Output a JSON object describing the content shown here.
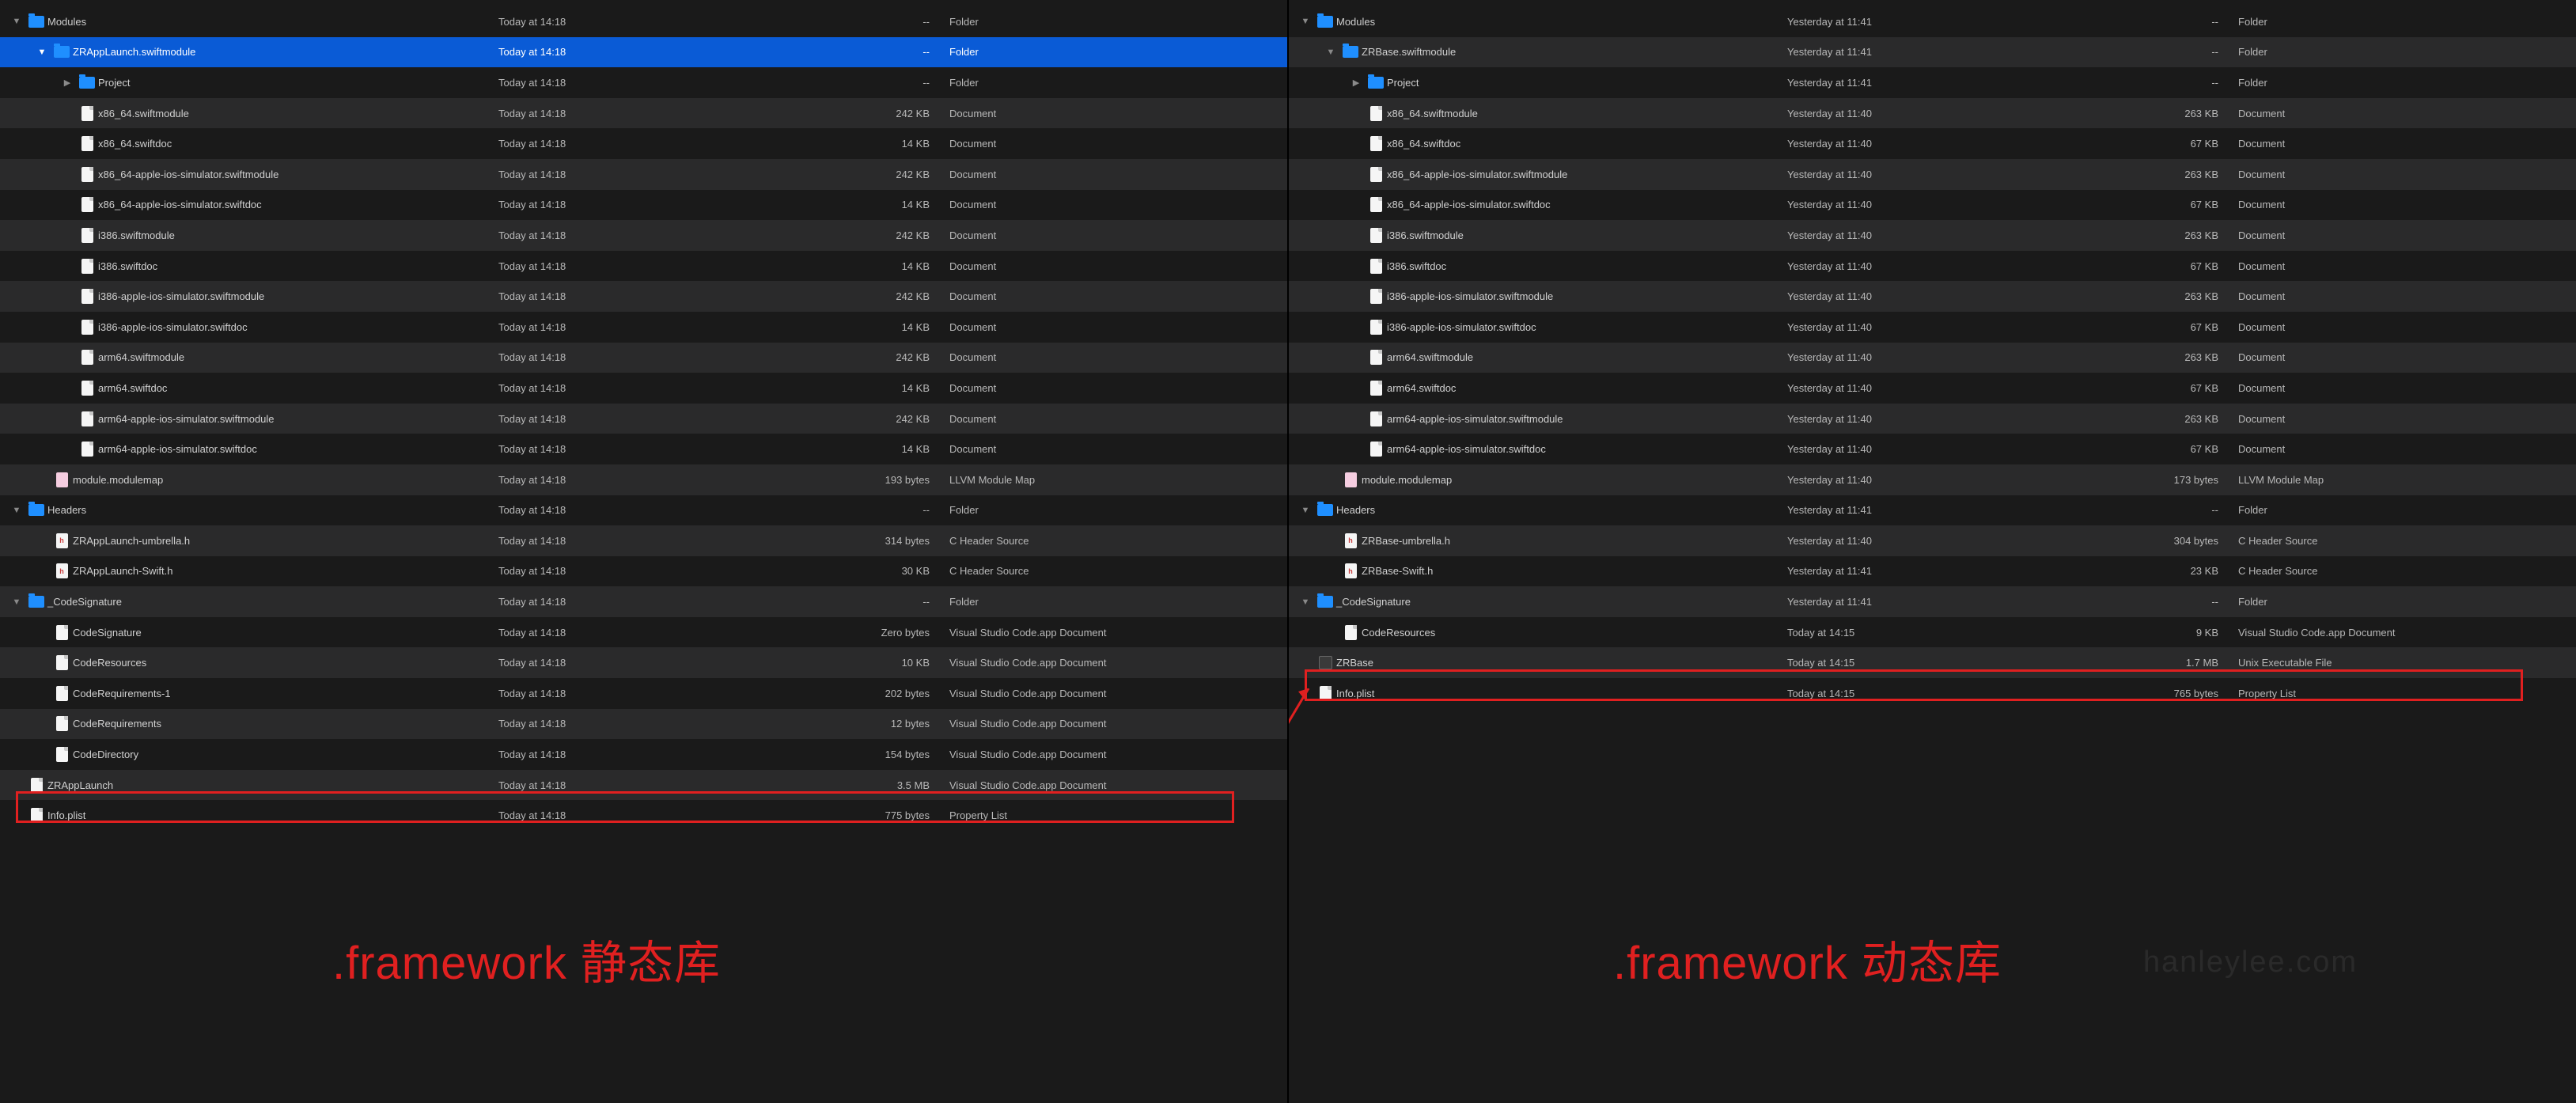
{
  "left": {
    "caption": ".framework 静态库",
    "rows": [
      {
        "indent": 0,
        "disc": "down",
        "icon": "folder",
        "name": "Modules",
        "date": "Today at 14:18",
        "size": "--",
        "kind": "Folder",
        "alt": false,
        "sel": false
      },
      {
        "indent": 1,
        "disc": "down",
        "icon": "folder",
        "name": "ZRAppLaunch.swiftmodule",
        "date": "Today at 14:18",
        "size": "--",
        "kind": "Folder",
        "alt": true,
        "sel": true
      },
      {
        "indent": 2,
        "disc": "right",
        "icon": "folder",
        "name": "Project",
        "date": "Today at 14:18",
        "size": "--",
        "kind": "Folder",
        "alt": false,
        "sel": false
      },
      {
        "indent": 2,
        "disc": "",
        "icon": "doc",
        "name": "x86_64.swiftmodule",
        "date": "Today at 14:18",
        "size": "242 KB",
        "kind": "Document",
        "alt": true,
        "sel": false
      },
      {
        "indent": 2,
        "disc": "",
        "icon": "doc",
        "name": "x86_64.swiftdoc",
        "date": "Today at 14:18",
        "size": "14 KB",
        "kind": "Document",
        "alt": false,
        "sel": false
      },
      {
        "indent": 2,
        "disc": "",
        "icon": "doc",
        "name": "x86_64-apple-ios-simulator.swiftmodule",
        "date": "Today at 14:18",
        "size": "242 KB",
        "kind": "Document",
        "alt": true,
        "sel": false
      },
      {
        "indent": 2,
        "disc": "",
        "icon": "doc",
        "name": "x86_64-apple-ios-simulator.swiftdoc",
        "date": "Today at 14:18",
        "size": "14 KB",
        "kind": "Document",
        "alt": false,
        "sel": false
      },
      {
        "indent": 2,
        "disc": "",
        "icon": "doc",
        "name": "i386.swiftmodule",
        "date": "Today at 14:18",
        "size": "242 KB",
        "kind": "Document",
        "alt": true,
        "sel": false
      },
      {
        "indent": 2,
        "disc": "",
        "icon": "doc",
        "name": "i386.swiftdoc",
        "date": "Today at 14:18",
        "size": "14 KB",
        "kind": "Document",
        "alt": false,
        "sel": false
      },
      {
        "indent": 2,
        "disc": "",
        "icon": "doc",
        "name": "i386-apple-ios-simulator.swiftmodule",
        "date": "Today at 14:18",
        "size": "242 KB",
        "kind": "Document",
        "alt": true,
        "sel": false
      },
      {
        "indent": 2,
        "disc": "",
        "icon": "doc",
        "name": "i386-apple-ios-simulator.swiftdoc",
        "date": "Today at 14:18",
        "size": "14 KB",
        "kind": "Document",
        "alt": false,
        "sel": false
      },
      {
        "indent": 2,
        "disc": "",
        "icon": "doc",
        "name": "arm64.swiftmodule",
        "date": "Today at 14:18",
        "size": "242 KB",
        "kind": "Document",
        "alt": true,
        "sel": false
      },
      {
        "indent": 2,
        "disc": "",
        "icon": "doc",
        "name": "arm64.swiftdoc",
        "date": "Today at 14:18",
        "size": "14 KB",
        "kind": "Document",
        "alt": false,
        "sel": false
      },
      {
        "indent": 2,
        "disc": "",
        "icon": "doc",
        "name": "arm64-apple-ios-simulator.swiftmodule",
        "date": "Today at 14:18",
        "size": "242 KB",
        "kind": "Document",
        "alt": true,
        "sel": false
      },
      {
        "indent": 2,
        "disc": "",
        "icon": "doc",
        "name": "arm64-apple-ios-simulator.swiftdoc",
        "date": "Today at 14:18",
        "size": "14 KB",
        "kind": "Document",
        "alt": false,
        "sel": false
      },
      {
        "indent": 1,
        "disc": "",
        "icon": "map",
        "name": "module.modulemap",
        "date": "Today at 14:18",
        "size": "193 bytes",
        "kind": "LLVM Module Map",
        "alt": true,
        "sel": false
      },
      {
        "indent": 0,
        "disc": "down",
        "icon": "folder",
        "name": "Headers",
        "date": "Today at 14:18",
        "size": "--",
        "kind": "Folder",
        "alt": false,
        "sel": false
      },
      {
        "indent": 1,
        "disc": "",
        "icon": "h",
        "name": "ZRAppLaunch-umbrella.h",
        "date": "Today at 14:18",
        "size": "314 bytes",
        "kind": "C Header Source",
        "alt": true,
        "sel": false
      },
      {
        "indent": 1,
        "disc": "",
        "icon": "h",
        "name": "ZRAppLaunch-Swift.h",
        "date": "Today at 14:18",
        "size": "30 KB",
        "kind": "C Header Source",
        "alt": false,
        "sel": false
      },
      {
        "indent": 0,
        "disc": "down",
        "icon": "folder",
        "name": "_CodeSignature",
        "date": "Today at 14:18",
        "size": "--",
        "kind": "Folder",
        "alt": true,
        "sel": false
      },
      {
        "indent": 1,
        "disc": "",
        "icon": "doc",
        "name": "CodeSignature",
        "date": "Today at 14:18",
        "size": "Zero bytes",
        "kind": "Visual Studio Code.app Document",
        "alt": false,
        "sel": false
      },
      {
        "indent": 1,
        "disc": "",
        "icon": "doc",
        "name": "CodeResources",
        "date": "Today at 14:18",
        "size": "10 KB",
        "kind": "Visual Studio Code.app Document",
        "alt": true,
        "sel": false
      },
      {
        "indent": 1,
        "disc": "",
        "icon": "doc",
        "name": "CodeRequirements-1",
        "date": "Today at 14:18",
        "size": "202 bytes",
        "kind": "Visual Studio Code.app Document",
        "alt": false,
        "sel": false
      },
      {
        "indent": 1,
        "disc": "",
        "icon": "doc",
        "name": "CodeRequirements",
        "date": "Today at 14:18",
        "size": "12 bytes",
        "kind": "Visual Studio Code.app Document",
        "alt": true,
        "sel": false
      },
      {
        "indent": 1,
        "disc": "",
        "icon": "doc",
        "name": "CodeDirectory",
        "date": "Today at 14:18",
        "size": "154 bytes",
        "kind": "Visual Studio Code.app Document",
        "alt": false,
        "sel": false
      },
      {
        "indent": 0,
        "disc": "",
        "icon": "doc",
        "name": "ZRAppLaunch",
        "date": "Today at 14:18",
        "size": "3.5 MB",
        "kind": "Visual Studio Code.app Document",
        "alt": true,
        "sel": false
      },
      {
        "indent": 0,
        "disc": "",
        "icon": "doc",
        "name": "Info.plist",
        "date": "Today at 14:18",
        "size": "775 bytes",
        "kind": "Property List",
        "alt": false,
        "sel": false
      }
    ]
  },
  "right": {
    "caption": ".framework 动态库",
    "watermark": "hanleylee.com",
    "rows": [
      {
        "indent": 0,
        "disc": "down",
        "icon": "folder",
        "name": "Modules",
        "date": "Yesterday at 11:41",
        "size": "--",
        "kind": "Folder",
        "alt": false,
        "sel": false
      },
      {
        "indent": 1,
        "disc": "down",
        "icon": "folder",
        "name": "ZRBase.swiftmodule",
        "date": "Yesterday at 11:41",
        "size": "--",
        "kind": "Folder",
        "alt": true,
        "sel": false
      },
      {
        "indent": 2,
        "disc": "right",
        "icon": "folder",
        "name": "Project",
        "date": "Yesterday at 11:41",
        "size": "--",
        "kind": "Folder",
        "alt": false,
        "sel": false
      },
      {
        "indent": 2,
        "disc": "",
        "icon": "doc",
        "name": "x86_64.swiftmodule",
        "date": "Yesterday at 11:40",
        "size": "263 KB",
        "kind": "Document",
        "alt": true,
        "sel": false
      },
      {
        "indent": 2,
        "disc": "",
        "icon": "doc",
        "name": "x86_64.swiftdoc",
        "date": "Yesterday at 11:40",
        "size": "67 KB",
        "kind": "Document",
        "alt": false,
        "sel": false
      },
      {
        "indent": 2,
        "disc": "",
        "icon": "doc",
        "name": "x86_64-apple-ios-simulator.swiftmodule",
        "date": "Yesterday at 11:40",
        "size": "263 KB",
        "kind": "Document",
        "alt": true,
        "sel": false
      },
      {
        "indent": 2,
        "disc": "",
        "icon": "doc",
        "name": "x86_64-apple-ios-simulator.swiftdoc",
        "date": "Yesterday at 11:40",
        "size": "67 KB",
        "kind": "Document",
        "alt": false,
        "sel": false
      },
      {
        "indent": 2,
        "disc": "",
        "icon": "doc",
        "name": "i386.swiftmodule",
        "date": "Yesterday at 11:40",
        "size": "263 KB",
        "kind": "Document",
        "alt": true,
        "sel": false
      },
      {
        "indent": 2,
        "disc": "",
        "icon": "doc",
        "name": "i386.swiftdoc",
        "date": "Yesterday at 11:40",
        "size": "67 KB",
        "kind": "Document",
        "alt": false,
        "sel": false
      },
      {
        "indent": 2,
        "disc": "",
        "icon": "doc",
        "name": "i386-apple-ios-simulator.swiftmodule",
        "date": "Yesterday at 11:40",
        "size": "263 KB",
        "kind": "Document",
        "alt": true,
        "sel": false
      },
      {
        "indent": 2,
        "disc": "",
        "icon": "doc",
        "name": "i386-apple-ios-simulator.swiftdoc",
        "date": "Yesterday at 11:40",
        "size": "67 KB",
        "kind": "Document",
        "alt": false,
        "sel": false
      },
      {
        "indent": 2,
        "disc": "",
        "icon": "doc",
        "name": "arm64.swiftmodule",
        "date": "Yesterday at 11:40",
        "size": "263 KB",
        "kind": "Document",
        "alt": true,
        "sel": false
      },
      {
        "indent": 2,
        "disc": "",
        "icon": "doc",
        "name": "arm64.swiftdoc",
        "date": "Yesterday at 11:40",
        "size": "67 KB",
        "kind": "Document",
        "alt": false,
        "sel": false
      },
      {
        "indent": 2,
        "disc": "",
        "icon": "doc",
        "name": "arm64-apple-ios-simulator.swiftmodule",
        "date": "Yesterday at 11:40",
        "size": "263 KB",
        "kind": "Document",
        "alt": true,
        "sel": false
      },
      {
        "indent": 2,
        "disc": "",
        "icon": "doc",
        "name": "arm64-apple-ios-simulator.swiftdoc",
        "date": "Yesterday at 11:40",
        "size": "67 KB",
        "kind": "Document",
        "alt": false,
        "sel": false
      },
      {
        "indent": 1,
        "disc": "",
        "icon": "map",
        "name": "module.modulemap",
        "date": "Yesterday at 11:40",
        "size": "173 bytes",
        "kind": "LLVM Module Map",
        "alt": true,
        "sel": false
      },
      {
        "indent": 0,
        "disc": "down",
        "icon": "folder",
        "name": "Headers",
        "date": "Yesterday at 11:41",
        "size": "--",
        "kind": "Folder",
        "alt": false,
        "sel": false
      },
      {
        "indent": 1,
        "disc": "",
        "icon": "h",
        "name": "ZRBase-umbrella.h",
        "date": "Yesterday at 11:40",
        "size": "304 bytes",
        "kind": "C Header Source",
        "alt": true,
        "sel": false
      },
      {
        "indent": 1,
        "disc": "",
        "icon": "h",
        "name": "ZRBase-Swift.h",
        "date": "Yesterday at 11:41",
        "size": "23 KB",
        "kind": "C Header Source",
        "alt": false,
        "sel": false
      },
      {
        "indent": 0,
        "disc": "down",
        "icon": "folder",
        "name": "_CodeSignature",
        "date": "Yesterday at 11:41",
        "size": "--",
        "kind": "Folder",
        "alt": true,
        "sel": false
      },
      {
        "indent": 1,
        "disc": "",
        "icon": "doc",
        "name": "CodeResources",
        "date": "Today at 14:15",
        "size": "9 KB",
        "kind": "Visual Studio Code.app Document",
        "alt": false,
        "sel": false
      },
      {
        "indent": 0,
        "disc": "",
        "icon": "exec",
        "name": "ZRBase",
        "date": "Today at 14:15",
        "size": "1.7 MB",
        "kind": "Unix Executable File",
        "alt": true,
        "sel": false
      },
      {
        "indent": 0,
        "disc": "",
        "icon": "doc",
        "name": "Info.plist",
        "date": "Today at 14:15",
        "size": "765 bytes",
        "kind": "Property List",
        "alt": false,
        "sel": false
      }
    ]
  }
}
